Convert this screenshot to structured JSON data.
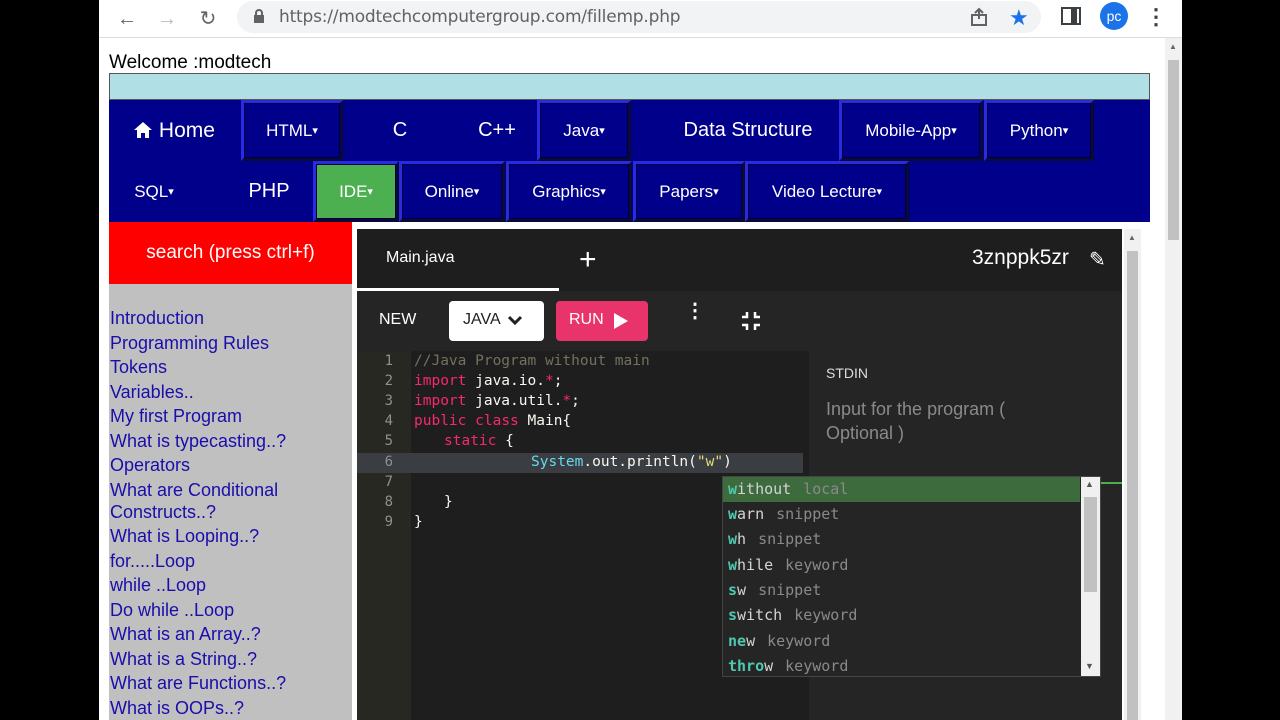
{
  "browser": {
    "url": "https://modtechcomputergroup.com/fillemp.php",
    "profile_initials": "pc"
  },
  "page": {
    "welcome": "Welcome :modtech"
  },
  "nav": {
    "items": [
      {
        "label": "Home",
        "caret": false
      },
      {
        "label": "HTML",
        "caret": true
      },
      {
        "label": "C",
        "caret": false
      },
      {
        "label": "C++",
        "caret": false
      },
      {
        "label": "Java",
        "caret": true
      },
      {
        "label": "Data Structure",
        "caret": false
      },
      {
        "label": "Mobile-App",
        "caret": true
      },
      {
        "label": "Python",
        "caret": true
      },
      {
        "label": "SQL",
        "caret": true
      },
      {
        "label": "PHP",
        "caret": false
      },
      {
        "label": "IDE",
        "caret": true
      },
      {
        "label": "Online",
        "caret": true
      },
      {
        "label": "Graphics",
        "caret": true
      },
      {
        "label": "Papers",
        "caret": true
      },
      {
        "label": "Video Lecture",
        "caret": true
      }
    ],
    "caret_glyph": "▾",
    "active_color": "#4caf50"
  },
  "search": {
    "label": "search (press ctrl+f)"
  },
  "sidebar": {
    "links": [
      "Introduction",
      "Programming Rules",
      "Tokens",
      "Variables..",
      "My first Program",
      "What is typecasting..?",
      "Operators",
      "What are Conditional Constructs..?",
      "What is Looping..?",
      "for.....Loop",
      "while ..Loop",
      "Do while ..Loop",
      "What is an Array..?",
      "What is a String..?",
      "What are Functions..?",
      "What is OOPs..?"
    ]
  },
  "ide": {
    "tab_label": "Main.java",
    "snippet_id": "3znppk5zr",
    "new_label": "NEW",
    "language": "JAVA",
    "run_label": "RUN",
    "stdin_label": "STDIN",
    "stdin_placeholder": "Input for the program ( Optional )",
    "line_numbers": [
      "1",
      "2",
      "3",
      "4",
      "5",
      "6",
      "7",
      "8",
      "9"
    ],
    "code": {
      "l1": "//Java Program without main",
      "l2_kw": "import",
      "l2_rest": " java.io.",
      "l2_star": "*",
      "l2_end": ";",
      "l3_kw": "import",
      "l3_rest": " java.util.",
      "l3_star": "*",
      "l3_end": ";",
      "l4_kw1": "public",
      "l4_kw2": "class",
      "l4_rest": " Main{",
      "l5_kw": "static",
      "l5_rest": " {",
      "l6_fn": "System",
      "l6_rest": ".out.println(",
      "l6_str": "\"w\"",
      "l6_end": ")",
      "l8": "}",
      "l9": "}"
    }
  },
  "autocomplete": {
    "items": [
      {
        "match": "w",
        "rest": "ithout",
        "type": "local"
      },
      {
        "match": "w",
        "rest": "arn",
        "type": "snippet"
      },
      {
        "match": "w",
        "rest": "h",
        "type": "snippet"
      },
      {
        "match": "w",
        "rest": "hile",
        "type": "keyword"
      },
      {
        "match": "s",
        "rest": "w",
        "type": "snippet"
      },
      {
        "match": "s",
        "rest": "witch",
        "type": "keyword"
      },
      {
        "match": "ne",
        "rest": "w",
        "type": "keyword"
      },
      {
        "match": "thro",
        "rest": "w",
        "type": "keyword"
      }
    ]
  }
}
